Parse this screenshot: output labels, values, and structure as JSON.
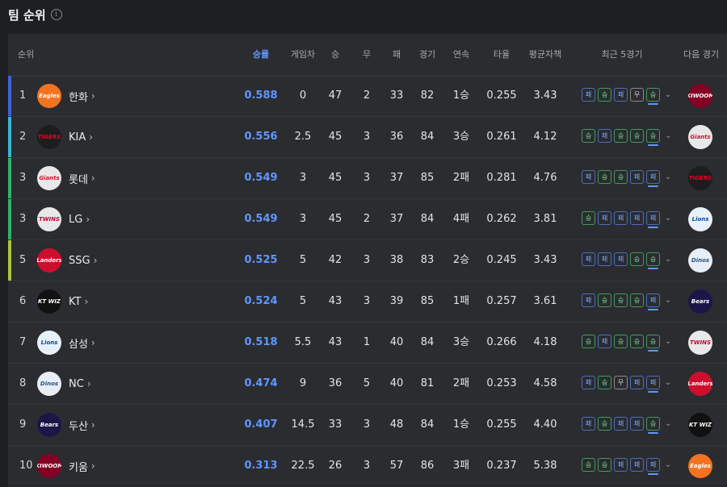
{
  "page": {
    "title": "팀 순위",
    "info_icon": "i"
  },
  "columns": {
    "rank": "순위",
    "pct": "승률",
    "gb": "게임차",
    "w": "승",
    "d": "무",
    "l": "패",
    "g": "경기",
    "streak": "연속",
    "avg": "타율",
    "era": "평균자책",
    "recent": "최근 5경기",
    "next": "다음 경기"
  },
  "colors": {
    "accent": "#5f97ff",
    "win": "#3f9c5c",
    "loss": "#4a6fbf"
  },
  "teams": [
    {
      "rank": "1",
      "name": "한화",
      "pct": "0.588",
      "gb": "0",
      "w": "47",
      "d": "2",
      "l": "33",
      "g": "82",
      "streak": "1승",
      "avg": "0.255",
      "era": "3.43",
      "recent": [
        "패",
        "승",
        "패",
        "무",
        "승"
      ],
      "bar": "#3f63d9",
      "logo": {
        "text": "Eagles",
        "icon": "eagles-logo",
        "bg": "#f37321",
        "fg": "#ffffff"
      },
      "next": {
        "text": "KIWOOM",
        "icon": "heroes-logo",
        "bg": "#820024",
        "fg": "#ffffff"
      }
    },
    {
      "rank": "2",
      "name": "KIA",
      "pct": "0.556",
      "gb": "2.5",
      "w": "45",
      "d": "3",
      "l": "36",
      "g": "84",
      "streak": "3승",
      "avg": "0.261",
      "era": "4.12",
      "recent": [
        "승",
        "패",
        "승",
        "승",
        "승"
      ],
      "bar": "#34b8d0",
      "logo": {
        "text": "TIGERS",
        "icon": "tigers-logo",
        "bg": "#1d1d1d",
        "fg": "#ea0029"
      },
      "next": {
        "text": "Giants",
        "icon": "giants-logo",
        "bg": "#e8e8e8",
        "fg": "#d00f31"
      }
    },
    {
      "rank": "3",
      "name": "롯데",
      "pct": "0.549",
      "gb": "3",
      "w": "45",
      "d": "3",
      "l": "37",
      "g": "85",
      "streak": "2패",
      "avg": "0.281",
      "era": "4.76",
      "recent": [
        "패",
        "승",
        "승",
        "패",
        "패"
      ],
      "bar": "#2fb36a",
      "logo": {
        "text": "Giants",
        "icon": "giants-logo",
        "bg": "#e8e8e8",
        "fg": "#d00f31"
      },
      "next": {
        "text": "TIGERS",
        "icon": "tigers-logo",
        "bg": "#1d1d1d",
        "fg": "#ea0029"
      }
    },
    {
      "rank": "3",
      "name": "LG",
      "pct": "0.549",
      "gb": "3",
      "w": "45",
      "d": "2",
      "l": "37",
      "g": "84",
      "streak": "4패",
      "avg": "0.262",
      "era": "3.81",
      "recent": [
        "승",
        "패",
        "패",
        "패",
        "패"
      ],
      "bar": "#2fb36a",
      "logo": {
        "text": "TWINS",
        "icon": "twins-logo",
        "bg": "#e8e8e8",
        "fg": "#c30037"
      },
      "next": {
        "text": "Lions",
        "icon": "lions-logo",
        "bg": "#e8f0fa",
        "fg": "#074ca1"
      }
    },
    {
      "rank": "5",
      "name": "SSG",
      "pct": "0.525",
      "gb": "5",
      "w": "42",
      "d": "3",
      "l": "38",
      "g": "83",
      "streak": "2승",
      "avg": "0.245",
      "era": "3.43",
      "recent": [
        "패",
        "패",
        "패",
        "승",
        "승"
      ],
      "bar": "#a8c83a",
      "logo": {
        "text": "Landers",
        "icon": "landers-logo",
        "bg": "#ce0e2d",
        "fg": "#ffffff"
      },
      "next": {
        "text": "Dinos",
        "icon": "dinos-logo",
        "bg": "#e8eef6",
        "fg": "#315288"
      }
    },
    {
      "rank": "6",
      "name": "KT",
      "pct": "0.524",
      "gb": "5",
      "w": "43",
      "d": "3",
      "l": "39",
      "g": "85",
      "streak": "1패",
      "avg": "0.257",
      "era": "3.61",
      "recent": [
        "패",
        "승",
        "승",
        "승",
        "패"
      ],
      "bar": "",
      "logo": {
        "text": "KT WIZ",
        "icon": "wiz-logo",
        "bg": "#111111",
        "fg": "#ffffff"
      },
      "next": {
        "text": "Bears",
        "icon": "bears-logo",
        "bg": "#1a1748",
        "fg": "#ffffff"
      }
    },
    {
      "rank": "7",
      "name": "삼성",
      "pct": "0.518",
      "gb": "5.5",
      "w": "43",
      "d": "1",
      "l": "40",
      "g": "84",
      "streak": "3승",
      "avg": "0.266",
      "era": "4.18",
      "recent": [
        "승",
        "패",
        "승",
        "승",
        "승"
      ],
      "bar": "",
      "logo": {
        "text": "Lions",
        "icon": "lions-logo",
        "bg": "#e8f0fa",
        "fg": "#074ca1"
      },
      "next": {
        "text": "TWINS",
        "icon": "twins-logo",
        "bg": "#e8e8e8",
        "fg": "#c30037"
      }
    },
    {
      "rank": "8",
      "name": "NC",
      "pct": "0.474",
      "gb": "9",
      "w": "36",
      "d": "5",
      "l": "40",
      "g": "81",
      "streak": "2패",
      "avg": "0.253",
      "era": "4.58",
      "recent": [
        "패",
        "승",
        "무",
        "패",
        "패"
      ],
      "bar": "",
      "logo": {
        "text": "Dinos",
        "icon": "dinos-logo",
        "bg": "#e8eef6",
        "fg": "#315288"
      },
      "next": {
        "text": "Landers",
        "icon": "landers-logo",
        "bg": "#ce0e2d",
        "fg": "#ffffff"
      }
    },
    {
      "rank": "9",
      "name": "두산",
      "pct": "0.407",
      "gb": "14.5",
      "w": "33",
      "d": "3",
      "l": "48",
      "g": "84",
      "streak": "1승",
      "avg": "0.255",
      "era": "4.40",
      "recent": [
        "패",
        "승",
        "패",
        "패",
        "승"
      ],
      "bar": "",
      "logo": {
        "text": "Bears",
        "icon": "bears-logo",
        "bg": "#1a1748",
        "fg": "#ffffff"
      },
      "next": {
        "text": "KT WIZ",
        "icon": "wiz-logo",
        "bg": "#111111",
        "fg": "#ffffff"
      }
    },
    {
      "rank": "10",
      "name": "키움",
      "pct": "0.313",
      "gb": "22.5",
      "w": "26",
      "d": "3",
      "l": "57",
      "g": "86",
      "streak": "3패",
      "avg": "0.237",
      "era": "5.38",
      "recent": [
        "승",
        "승",
        "패",
        "패",
        "패"
      ],
      "bar": "",
      "logo": {
        "text": "KIWOOM",
        "icon": "heroes-logo",
        "bg": "#820024",
        "fg": "#ffffff"
      },
      "next": {
        "text": "Eagles",
        "icon": "eagles-logo",
        "bg": "#f37321",
        "fg": "#ffffff"
      }
    }
  ]
}
